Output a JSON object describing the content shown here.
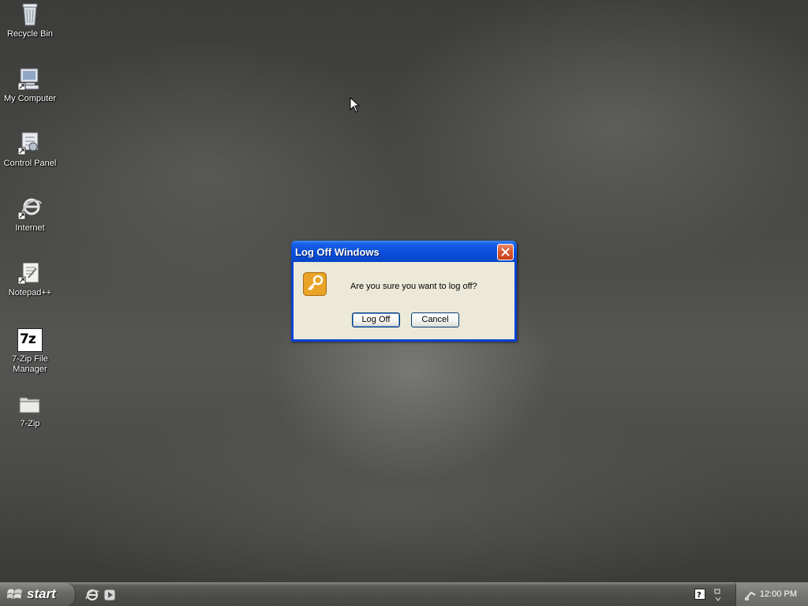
{
  "desktop": {
    "icons": [
      {
        "label": "Recycle Bin",
        "icon": "recycle-bin-icon"
      },
      {
        "label": "My Computer",
        "icon": "my-computer-icon"
      },
      {
        "label": "Control Panel",
        "icon": "control-panel-icon"
      },
      {
        "label": "Internet",
        "icon": "internet-icon"
      },
      {
        "label": "Notepad++",
        "icon": "notepadpp-icon"
      },
      {
        "label": "7-Zip File Manager",
        "icon": "7zip-icon"
      },
      {
        "label": "7-Zip",
        "icon": "folder-icon"
      }
    ],
    "seven_zip_glyph": "7z"
  },
  "dialog": {
    "title": "Log Off Windows",
    "message": "Are you sure you want to log off?",
    "log_off_label": "Log Off",
    "cancel_label": "Cancel",
    "icon": "key-icon"
  },
  "taskbar": {
    "start_label": "start",
    "quick_launch": [
      "internet-explorer-icon",
      "media-player-icon"
    ],
    "tray": {
      "clock": "12:00 PM",
      "icons": [
        "help-icon",
        "volume-icon",
        "network-icon"
      ]
    }
  },
  "colors": {
    "dialog_title_blue": "#0a4fdc",
    "dialog_body": "#ece9d8",
    "taskbar": "#4d4d4a",
    "close_red": "#d8542c"
  }
}
